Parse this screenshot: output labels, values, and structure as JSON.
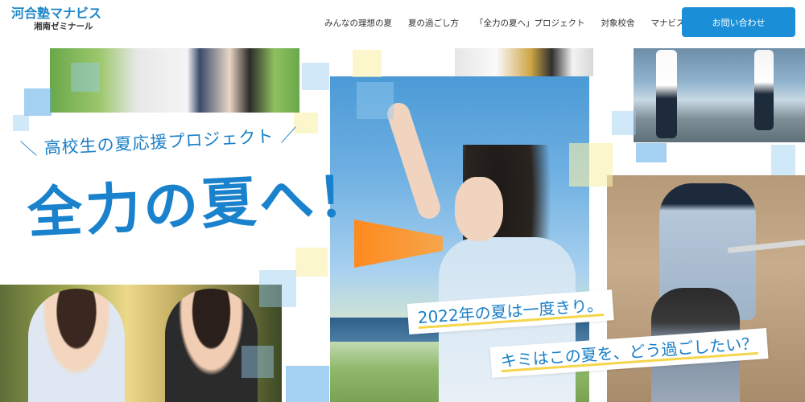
{
  "header": {
    "logo_main": "河合塾マナビス",
    "logo_sub": "湘南ゼミナール",
    "nav": [
      {
        "label": "みんなの理想の夏"
      },
      {
        "label": "夏の過ごし方"
      },
      {
        "label": "「全力の夏へ」プロジェクト"
      },
      {
        "label": "対象校舎"
      },
      {
        "label": "マナビスとは"
      }
    ],
    "contact_label": "お問い合わせ"
  },
  "hero": {
    "tagline_left": "＼",
    "tagline": "高校生の夏応援プロジェクト",
    "tagline_right": "／",
    "headline": "全力の夏へ！",
    "catch_1": "2022年の夏は一度きり。",
    "catch_2": "キミはこの夏を、どう過ごしたい？"
  },
  "colors": {
    "brand_blue": "#1a82cc",
    "button_blue": "#1a8fd8",
    "accent_yellow": "#f5d54a",
    "megaphone_orange": "#ff8a1f"
  }
}
